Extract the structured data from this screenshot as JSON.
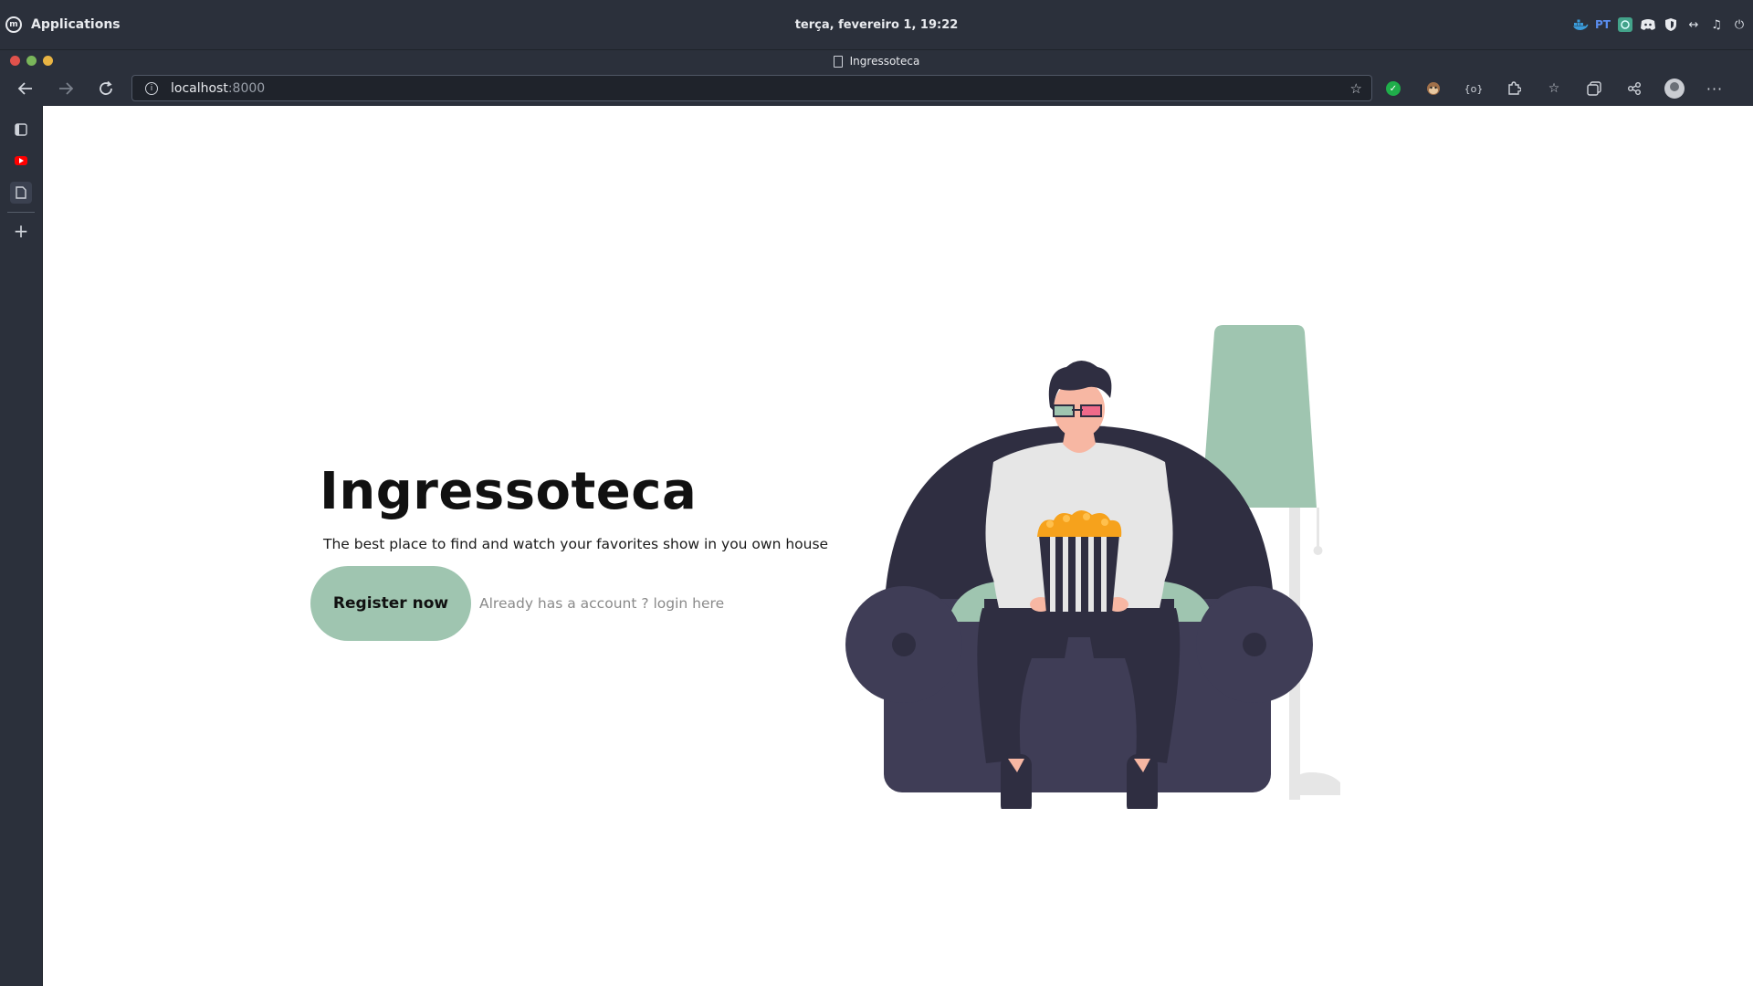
{
  "os": {
    "apps_label": "Applications",
    "clock": "terça, fevereiro  1, 19:22",
    "keyboard_layout": "PT",
    "tray_icons": [
      "docker-icon",
      "keyboard-layout",
      "network-app-icon",
      "discord-icon",
      "shield-icon",
      "network-arrows-icon",
      "music-icon",
      "power-icon"
    ]
  },
  "browser": {
    "tab_title": "Ingressoteca",
    "url_host": "localhost",
    "url_port": ":8000",
    "extensions": [
      "check-extension-icon",
      "monkey-extension-icon",
      "code-extension-icon",
      "puzzle-extensions-icon",
      "favorites-icon",
      "collections-icon",
      "share-icon",
      "profile-avatar",
      "more-menu-icon"
    ],
    "colors": {
      "chrome": "#2b303b",
      "url_bg": "#1f232b"
    }
  },
  "sidebar": {
    "items": [
      "tab-actions-icon",
      "youtube-icon",
      "page-icon",
      "add-icon"
    ]
  },
  "hero": {
    "title": "Ingressoteca",
    "subtitle": "The best place to find and watch your favorites show in you own house",
    "cta_label": "Register now",
    "login_text": "Already has a account ? login here"
  },
  "colors": {
    "accent": "#9fc5b0",
    "sofa": "#3f3d56",
    "popcorn": "#f6a21c",
    "glasses_pink": "#f06a8a"
  }
}
